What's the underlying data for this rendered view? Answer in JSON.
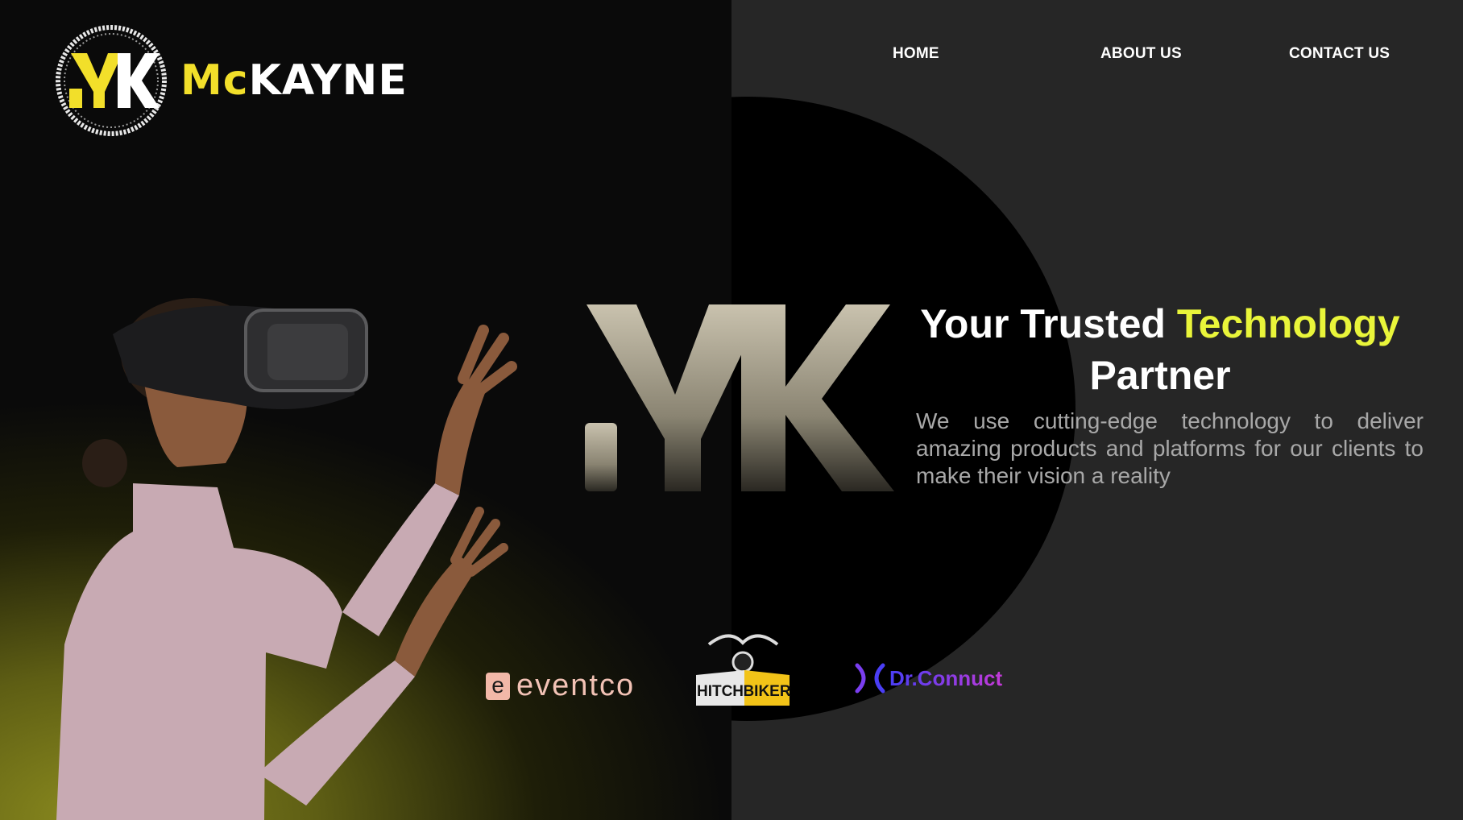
{
  "brand": {
    "monogram": "MK",
    "name_prefix": "Mc",
    "name_suffix": "KAYNE"
  },
  "nav": {
    "items": [
      {
        "label": "HOME"
      },
      {
        "label": "ABOUT US"
      },
      {
        "label": "CONTACT US"
      }
    ]
  },
  "hero": {
    "headline_part1": "Your Trusted ",
    "headline_accent": "Technology",
    "headline_part2": "Partner",
    "subtext": "We use cutting-edge technology to deliver amazing products and platforms for our clients to make their vision a reality",
    "watermark": "MK"
  },
  "partners": {
    "eventco": {
      "icon": "e",
      "label": "eventco"
    },
    "hitchbiker": {
      "label_a": "HITCH",
      "label_b": "BIKER"
    },
    "drconnuct": {
      "label": "Dr.Connuct"
    }
  },
  "colors": {
    "accent": "#e9f53a",
    "brand_yellow": "#f2df2a",
    "panel_dark": "#262626",
    "left_gradient": "#8a8a1e"
  },
  "icons": [
    "mk-logo-icon",
    "vr-person-illustration",
    "eventco-logo-icon",
    "hitchbiker-logo-icon",
    "drconnuct-logo-icon"
  ]
}
